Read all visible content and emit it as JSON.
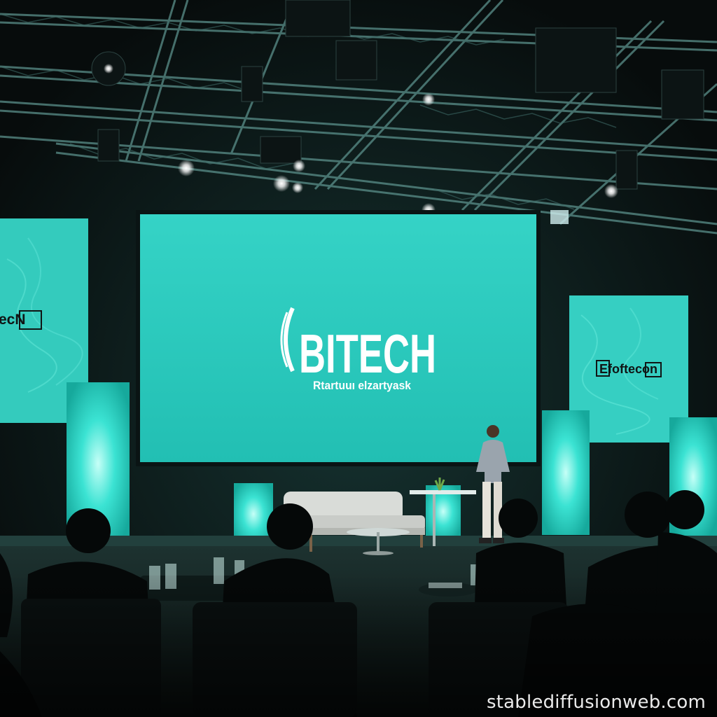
{
  "stage": {
    "main_screen": {
      "logo_text": "BITECH",
      "tagline": "Rtartuuı elzartyask"
    },
    "left_panel": {
      "text": "ecN"
    },
    "right_panel": {
      "text": "Efoftecon"
    }
  },
  "watermark": {
    "text": "stablediffusionweb.com"
  },
  "colors": {
    "accent_teal": "#2ad6c6",
    "screen_teal": "#27c7bb",
    "dark_background": "#0b1212"
  }
}
